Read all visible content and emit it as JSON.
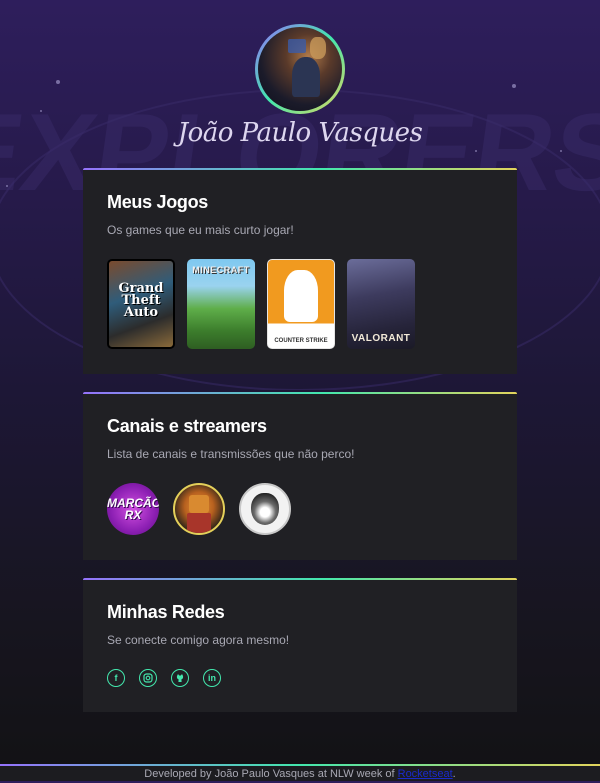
{
  "profile": {
    "name": "João Paulo Vasques",
    "avatar_icon": "profile-photo"
  },
  "games_card": {
    "title": "Meus Jogos",
    "subtitle": "Os games que eu mais curto jogar!",
    "games": [
      {
        "name": "GTA V",
        "label": "Grand Theft Auto"
      },
      {
        "name": "Minecraft",
        "label": "MINECRAFT"
      },
      {
        "name": "Counter Strike",
        "label": "COUNTER STRIKE"
      },
      {
        "name": "Valorant",
        "label": "VALORANT"
      }
    ]
  },
  "channels_card": {
    "title": "Canais e streamers",
    "subtitle": "Lista de canais e transmissões que não perco!",
    "channels": [
      {
        "name": "Marcão RX",
        "label": "MARCÃO RX"
      },
      {
        "name": "Minecraft fox streamer",
        "label": ""
      },
      {
        "name": "Tiger channel",
        "label": ""
      }
    ]
  },
  "socials_card": {
    "title": "Minhas Redes",
    "subtitle": "Se conecte comigo agora mesmo!",
    "links": [
      {
        "icon": "facebook-icon",
        "glyph": "f"
      },
      {
        "icon": "instagram-icon",
        "glyph": ""
      },
      {
        "icon": "github-icon",
        "glyph": ""
      },
      {
        "icon": "linkedin-icon",
        "glyph": "in"
      }
    ]
  },
  "footer": {
    "text": "Developed by João Paulo Vasques at NLW week of",
    "link_text": "Rocketseat",
    "suffix": "."
  },
  "colors": {
    "accent_green": "#43e7ad",
    "accent_purple": "#9572fc",
    "accent_yellow": "#e2d45c",
    "card_bg": "#202024"
  }
}
